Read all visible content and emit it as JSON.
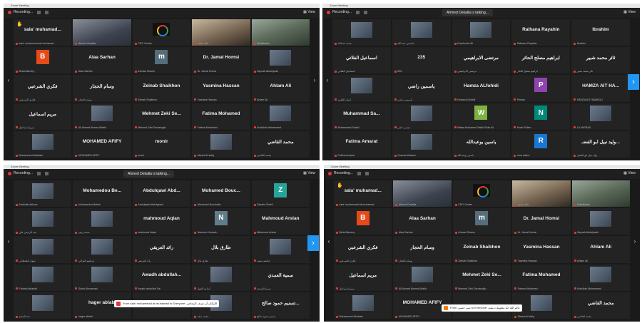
{
  "screens": [
    {
      "title": "Zoom Meeting",
      "recording": "Recording...",
      "view": "View",
      "talking": "",
      "arrows": {
        "left": "‹",
        "right": "›",
        "right_style": "normal"
      },
      "tiles": [
        {
          "name": "sala' muhamad...",
          "label": "sala' muhammad ali muhamad",
          "kind": "text",
          "hand": true
        },
        {
          "name": "",
          "label": "Ahmed Dekalla",
          "kind": "video"
        },
        {
          "name": "",
          "label": "CEO Center",
          "kind": "logo"
        },
        {
          "name": "",
          "label": "خالد محمد",
          "kind": "video-warm"
        },
        {
          "name": "",
          "label": "Abdulkarim",
          "kind": "video-green"
        },
        {
          "name": "",
          "label": "Belal Alamery",
          "kind": "avatar",
          "letter": "B",
          "color": "#e64a19"
        },
        {
          "name": "Alaa Sarhan",
          "label": "Alaa Sarhan",
          "kind": "text"
        },
        {
          "name": "",
          "label": "Ahmad Shams",
          "kind": "avatar",
          "letter": "m",
          "color": "#546e7a"
        },
        {
          "name": "Dr. Jamal Homsi",
          "label": "Dr. Jamal Homsi",
          "kind": "text"
        },
        {
          "name": "",
          "label": "Zaynab Abdulqadir",
          "kind": "photo"
        },
        {
          "name": "فكري الشرعبي",
          "label": "فكري الشرعبي",
          "kind": "text"
        },
        {
          "name": "وسام الحجار",
          "label": "وسام الحجار",
          "kind": "text"
        },
        {
          "name": "Zeinab Shaikhon",
          "label": "Zeinab Shaikhon",
          "kind": "text"
        },
        {
          "name": "Yasmina Hassan",
          "label": "Yasmina Hassan",
          "kind": "text"
        },
        {
          "name": "Ahlam Ali",
          "label": "Ahlam Ali",
          "kind": "text"
        },
        {
          "name": "مريم اسماعيل",
          "label": "مريم اسماعيل",
          "kind": "text"
        },
        {
          "name": "",
          "label": "Ali Ahmed Ahmed Alfatih",
          "kind": "photo"
        },
        {
          "name": "Mehmet Zeki Se...",
          "label": "Mehmet Zeki Serdaroğlu",
          "kind": "text"
        },
        {
          "name": "Fatima Mohamed",
          "label": "Fatima Mohamed",
          "kind": "text"
        },
        {
          "name": "",
          "label": "Abdullah Mohammed",
          "kind": "photo"
        },
        {
          "name": "",
          "label": "Mohammed Alhakam",
          "kind": "photo"
        },
        {
          "name": "MOHAMED AFIFY",
          "label": "MOHAMED AFIFY",
          "kind": "text"
        },
        {
          "name": "monir",
          "label": "monir",
          "kind": "text"
        },
        {
          "name": "",
          "label": "Marwa Al sidiq",
          "kind": "photo"
        },
        {
          "name": "محمد القاضي",
          "label": "محمد القاضي",
          "kind": "text"
        }
      ],
      "chats": []
    },
    {
      "title": "Zoom Meeting",
      "recording": "Recording...",
      "view": "View",
      "talking": "Ahmed Dekalla is talking...",
      "arrows": {
        "left": "‹",
        "right": "›",
        "right_style": "blue"
      },
      "tiles": [
        {
          "name": "",
          "label": "محمد عبدالله",
          "kind": "photo"
        },
        {
          "name": "",
          "label": "ياسمين عبد الله",
          "kind": "photo"
        },
        {
          "name": "",
          "label": "Kusnhmad Ali",
          "kind": "photo"
        },
        {
          "name": "Raihana Rayahin",
          "label": "Raihana Rayahin",
          "kind": "text"
        },
        {
          "name": "Ibrahim",
          "label": "Ibrahim",
          "kind": "text"
        },
        {
          "name": "اسماعيل الفلاتي",
          "label": "اسماعيل الفلاتي",
          "kind": "text"
        },
        {
          "name": "235",
          "label": "235",
          "kind": "text"
        },
        {
          "name": "مرتضى الابراهيمي",
          "label": "مرتضى الابراهيمي",
          "kind": "text"
        },
        {
          "name": "ابراهيم مصلح الحائر",
          "label": "ابراهيم مصلح الحائر",
          "kind": "text"
        },
        {
          "name": "ثائر محمد شبير",
          "label": "ثائر محمد شبير",
          "kind": "text"
        },
        {
          "name": "",
          "label": "ايمان الكعبي",
          "kind": "photo"
        },
        {
          "name": "ياسمين راضي",
          "label": "ياسمين راضي",
          "kind": "text"
        },
        {
          "name": "Hamza ALfohidi",
          "label": "Hamza ALfohidi",
          "kind": "text"
        },
        {
          "name": "",
          "label": "Plekan",
          "kind": "avatar",
          "letter": "P",
          "color": "#8e44ad"
        },
        {
          "name": "HAMZA AIT HA...",
          "label": "HAMZA AIT HAMMOU",
          "kind": "text"
        },
        {
          "name": "Muhammad Sa...",
          "label": "Muhammad Saalid",
          "kind": "text"
        },
        {
          "name": "",
          "label": "عيسى ناجي",
          "kind": "photo"
        },
        {
          "name": "",
          "label": "Walaa Mohamed Salah Eldin Ali",
          "kind": "avatar",
          "letter": "W",
          "color": "#7cb342"
        },
        {
          "name": "",
          "label": "Noah Eldein",
          "kind": "avatar",
          "letter": "N",
          "color": "#00897b"
        },
        {
          "name": "",
          "label": "LA MIGRAD",
          "kind": "photo"
        },
        {
          "name": "Fatima Amarat",
          "label": "Fatima Amarat",
          "kind": "text"
        },
        {
          "name": "",
          "label": "Osama Alhasan",
          "kind": "photo"
        },
        {
          "name": "ياسين بوعبدالله",
          "label": "ياسين بوعبدالله",
          "kind": "text"
        },
        {
          "name": "",
          "label": "rima salem",
          "kind": "avatar",
          "letter": "R",
          "color": "#1976d2"
        },
        {
          "name": "وليد نبيل ابو الفضـ...",
          "label": "وليد نبيل ابو الفضل",
          "kind": "text"
        }
      ],
      "chats": []
    },
    {
      "title": "Zoom Meeting",
      "recording": "Recording...",
      "view": "View",
      "talking": "Ahmed Dekalla is talking...",
      "arrows": {
        "left": "‹",
        "right": "›",
        "right_style": "blue"
      },
      "tiles": [
        {
          "name": "",
          "label": "Abdullah Ashour",
          "kind": "photo"
        },
        {
          "name": "Mohamedou Be...",
          "label": "Mohamedou Bebeh",
          "kind": "text"
        },
        {
          "name": "Abdulqawi Abd...",
          "label": "Abdulqawi Abdulghani",
          "kind": "text"
        },
        {
          "name": "Mohamed Bouc...",
          "label": "Mohamed Bouchalla",
          "kind": "text"
        },
        {
          "name": "",
          "label": "Zakaria Sherif",
          "kind": "avatar",
          "letter": "Z",
          "color": "#26a69a"
        },
        {
          "name": "",
          "label": "عبد الرحمن علي",
          "kind": "photo"
        },
        {
          "name": "",
          "label": "محمد زهير",
          "kind": "photo"
        },
        {
          "name": "mahmoud Aqlan",
          "label": "mahmoud Aqlan",
          "kind": "text"
        },
        {
          "name": "",
          "label": "Noureen Hussein",
          "kind": "avatar",
          "letter": "N",
          "color": "#607d8b"
        },
        {
          "name": "Mahmoud Arslan",
          "label": "Mahmoud Arslan",
          "kind": "text"
        },
        {
          "name": "",
          "label": "نجوى القحطاني",
          "kind": "photo"
        },
        {
          "name": "",
          "label": "ابراهيم الغزالي",
          "kind": "photo"
        },
        {
          "name": "رائد العريقي",
          "label": "رائد العريقي",
          "kind": "text"
        },
        {
          "name": "طارق بلال",
          "label": "طارق بلال",
          "kind": "text"
        },
        {
          "name": "",
          "label": "عائشة محمد",
          "kind": "photo"
        },
        {
          "name": "",
          "label": "Fahmid alhaddri",
          "kind": "photo"
        },
        {
          "name": "",
          "label": "Saleh Alnoamani",
          "kind": "photo"
        },
        {
          "name": "Awadh abdullah...",
          "label": "Awadh abdullah Sal",
          "kind": "text"
        },
        {
          "name": "",
          "label": "أسامة الغول",
          "kind": "photo"
        },
        {
          "name": "سمية العمدي",
          "label": "سمية العمدي",
          "kind": "text"
        },
        {
          "name": "",
          "label": "عبد المنعم",
          "kind": "photo"
        },
        {
          "name": "hager ablabl",
          "label": "hager ablabl",
          "kind": "text"
        },
        {
          "name": "",
          "label": "",
          "kind": "empty"
        },
        {
          "name": "",
          "label": "محمد سعد",
          "kind": "photo"
        },
        {
          "name": "تسنيم حمود صالح...",
          "label": "تسنيم حمود صالح",
          "kind": "text"
        }
      ],
      "chats": [
        {
          "text": "From sala' muhammad ali muhamad to Everyone: الإمكان أن نعرف المحاضر",
          "style": "red",
          "pos": "mid"
        }
      ]
    },
    {
      "title": "Zoom Meeting",
      "recording": "Recording...",
      "view": "View",
      "talking": "",
      "arrows": {
        "left": "‹",
        "right": "›",
        "right_style": "normal"
      },
      "tiles": [
        {
          "name": "sala' muhamad...",
          "label": "sala' muhammad ali muhamad",
          "kind": "text",
          "hand": true
        },
        {
          "name": "",
          "label": "Ahmed Dekalla",
          "kind": "video"
        },
        {
          "name": "",
          "label": "CEO Center",
          "kind": "logo"
        },
        {
          "name": "",
          "label": "خالد محمد",
          "kind": "video-warm"
        },
        {
          "name": "",
          "label": "Abdulkarim",
          "kind": "video-green"
        },
        {
          "name": "",
          "label": "Belal Alamery",
          "kind": "avatar",
          "letter": "B",
          "color": "#e64a19"
        },
        {
          "name": "Alaa Sarhan",
          "label": "Alaa Sarhan",
          "kind": "text"
        },
        {
          "name": "",
          "label": "Ahmad Shams",
          "kind": "avatar",
          "letter": "m",
          "color": "#546e7a"
        },
        {
          "name": "Dr. Jamal Homsi",
          "label": "Dr. Jamal Homsi",
          "kind": "text"
        },
        {
          "name": "",
          "label": "Zaynab Abdulqadir",
          "kind": "photo"
        },
        {
          "name": "فكري الشرعبي",
          "label": "فكري الشرعبي",
          "kind": "text"
        },
        {
          "name": "وسام الحجار",
          "label": "وسام الحجار",
          "kind": "text"
        },
        {
          "name": "Zeinab Shaikhon",
          "label": "Zeinab Shaikhon",
          "kind": "text"
        },
        {
          "name": "Yasmina Hassan",
          "label": "Yasmina Hassan",
          "kind": "text"
        },
        {
          "name": "Ahlam Ali",
          "label": "Ahlam Ali",
          "kind": "text"
        },
        {
          "name": "مريم اسماعيل",
          "label": "مريم اسماعيل",
          "kind": "text"
        },
        {
          "name": "",
          "label": "Ali Ahmed Ahmed Alfatih",
          "kind": "photo"
        },
        {
          "name": "Mehmet Zeki Se...",
          "label": "Mehmet Zeki Serdaroğlu",
          "kind": "text"
        },
        {
          "name": "Fatima Mohamed",
          "label": "Fatima Mohamed",
          "kind": "text"
        },
        {
          "name": "",
          "label": "Abdullah Mohammed",
          "kind": "photo"
        },
        {
          "name": "",
          "label": "Mohammed Alhakam",
          "kind": "photo"
        },
        {
          "name": "MOHAMED AFIFY",
          "label": "MOHAMED AFIFY",
          "kind": "text"
        },
        {
          "name": "",
          "label": "",
          "kind": "empty"
        },
        {
          "name": "",
          "label": "Marwa Al sidiq",
          "kind": "photo"
        },
        {
          "name": "محمد القاضي",
          "label": "محمد القاضي",
          "kind": "text"
        }
      ],
      "chats": [
        {
          "text": "From سير حسين to Everyone: عالم الله حيا معلومات مفيد",
          "style": "orange",
          "pos": "bottom"
        }
      ]
    }
  ]
}
